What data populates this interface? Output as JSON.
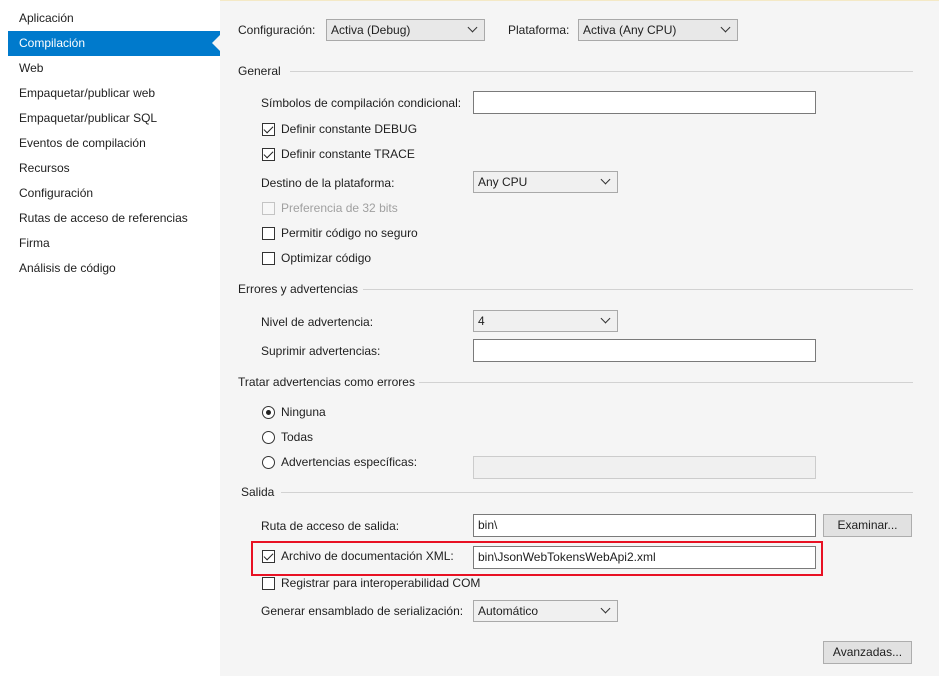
{
  "sidebar": {
    "items": [
      {
        "label": "Aplicación",
        "selected": false
      },
      {
        "label": "Compilación",
        "selected": true
      },
      {
        "label": "Web",
        "selected": false
      },
      {
        "label": "Empaquetar/publicar web",
        "selected": false
      },
      {
        "label": "Empaquetar/publicar SQL",
        "selected": false
      },
      {
        "label": "Eventos de compilación",
        "selected": false
      },
      {
        "label": "Recursos",
        "selected": false
      },
      {
        "label": "Configuración",
        "selected": false
      },
      {
        "label": "Rutas de acceso de referencias",
        "selected": false
      },
      {
        "label": "Firma",
        "selected": false
      },
      {
        "label": "Análisis de código",
        "selected": false
      }
    ]
  },
  "toolbar": {
    "config_label": "Configuración:",
    "config_value": "Activa (Debug)",
    "platform_label": "Plataforma:",
    "platform_value": "Activa (Any CPU)"
  },
  "general": {
    "header": "General",
    "symbols_label": "Símbolos de compilación condicional:",
    "symbols_value": "",
    "debug_label": "Definir constante DEBUG",
    "debug_checked": true,
    "trace_label": "Definir constante TRACE",
    "trace_checked": true,
    "target_label": "Destino de la plataforma:",
    "target_value": "Any CPU",
    "prefer32_label": "Preferencia de 32 bits",
    "prefer32_enabled": false,
    "unsafe_label": "Permitir código no seguro",
    "unsafe_checked": false,
    "optimize_label": "Optimizar código",
    "optimize_checked": false
  },
  "errors": {
    "header": "Errores y advertencias",
    "level_label": "Nivel de advertencia:",
    "level_value": "4",
    "suppress_label": "Suprimir advertencias:",
    "suppress_value": ""
  },
  "treat": {
    "header": "Tratar advertencias como errores",
    "none_label": "Ninguna",
    "all_label": "Todas",
    "specific_label": "Advertencias específicas:",
    "selected": "Ninguna",
    "specific_value": ""
  },
  "output": {
    "header": "Salida",
    "path_label": "Ruta de acceso de salida:",
    "path_value": "bin\\",
    "browse_label": "Examinar...",
    "xml_label": "Archivo de documentación XML:",
    "xml_checked": true,
    "xml_value": "bin\\JsonWebTokensWebApi2.xml",
    "com_label": "Registrar para interoperabilidad COM",
    "com_checked": false,
    "serial_label": "Generar ensamblado de serialización:",
    "serial_value": "Automático",
    "advanced_label": "Avanzadas..."
  },
  "colors": {
    "accent": "#007acc",
    "highlight": "#e81123",
    "panel": "#f5f5f5"
  }
}
